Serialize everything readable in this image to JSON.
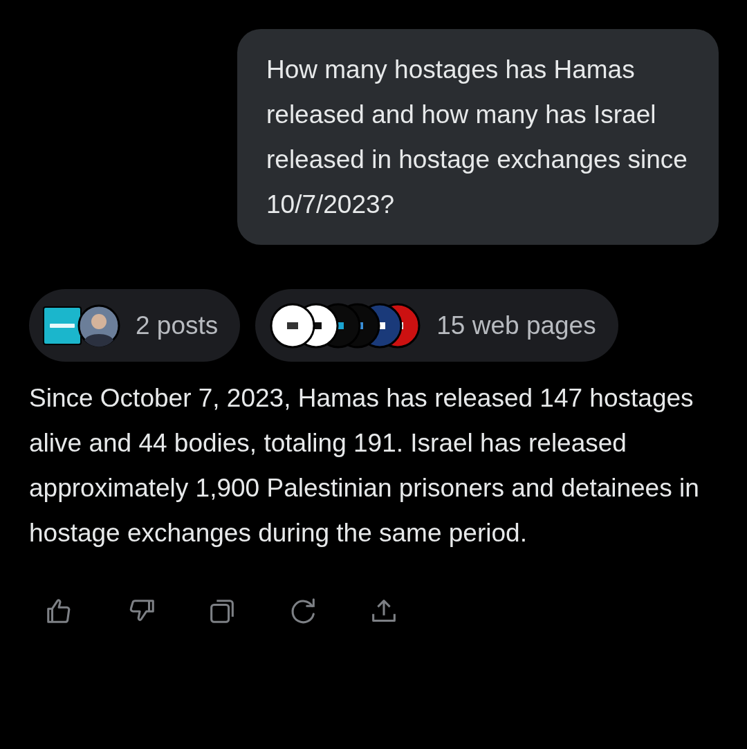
{
  "user_message": {
    "text": "How many hostages has Hamas released and how many has Israel released in hostage exchanges since 10/7/2023?"
  },
  "sources": [
    {
      "kind": "posts",
      "label": "2 posts"
    },
    {
      "kind": "web",
      "label": "15 web pages"
    }
  ],
  "answer": {
    "text": "Since October 7, 2023, Hamas has released 147 hostages alive and 44 bodies, totaling 191. Israel has released approximately 1,900 Palestinian prisoners and detainees in hostage exchanges during the same period."
  }
}
